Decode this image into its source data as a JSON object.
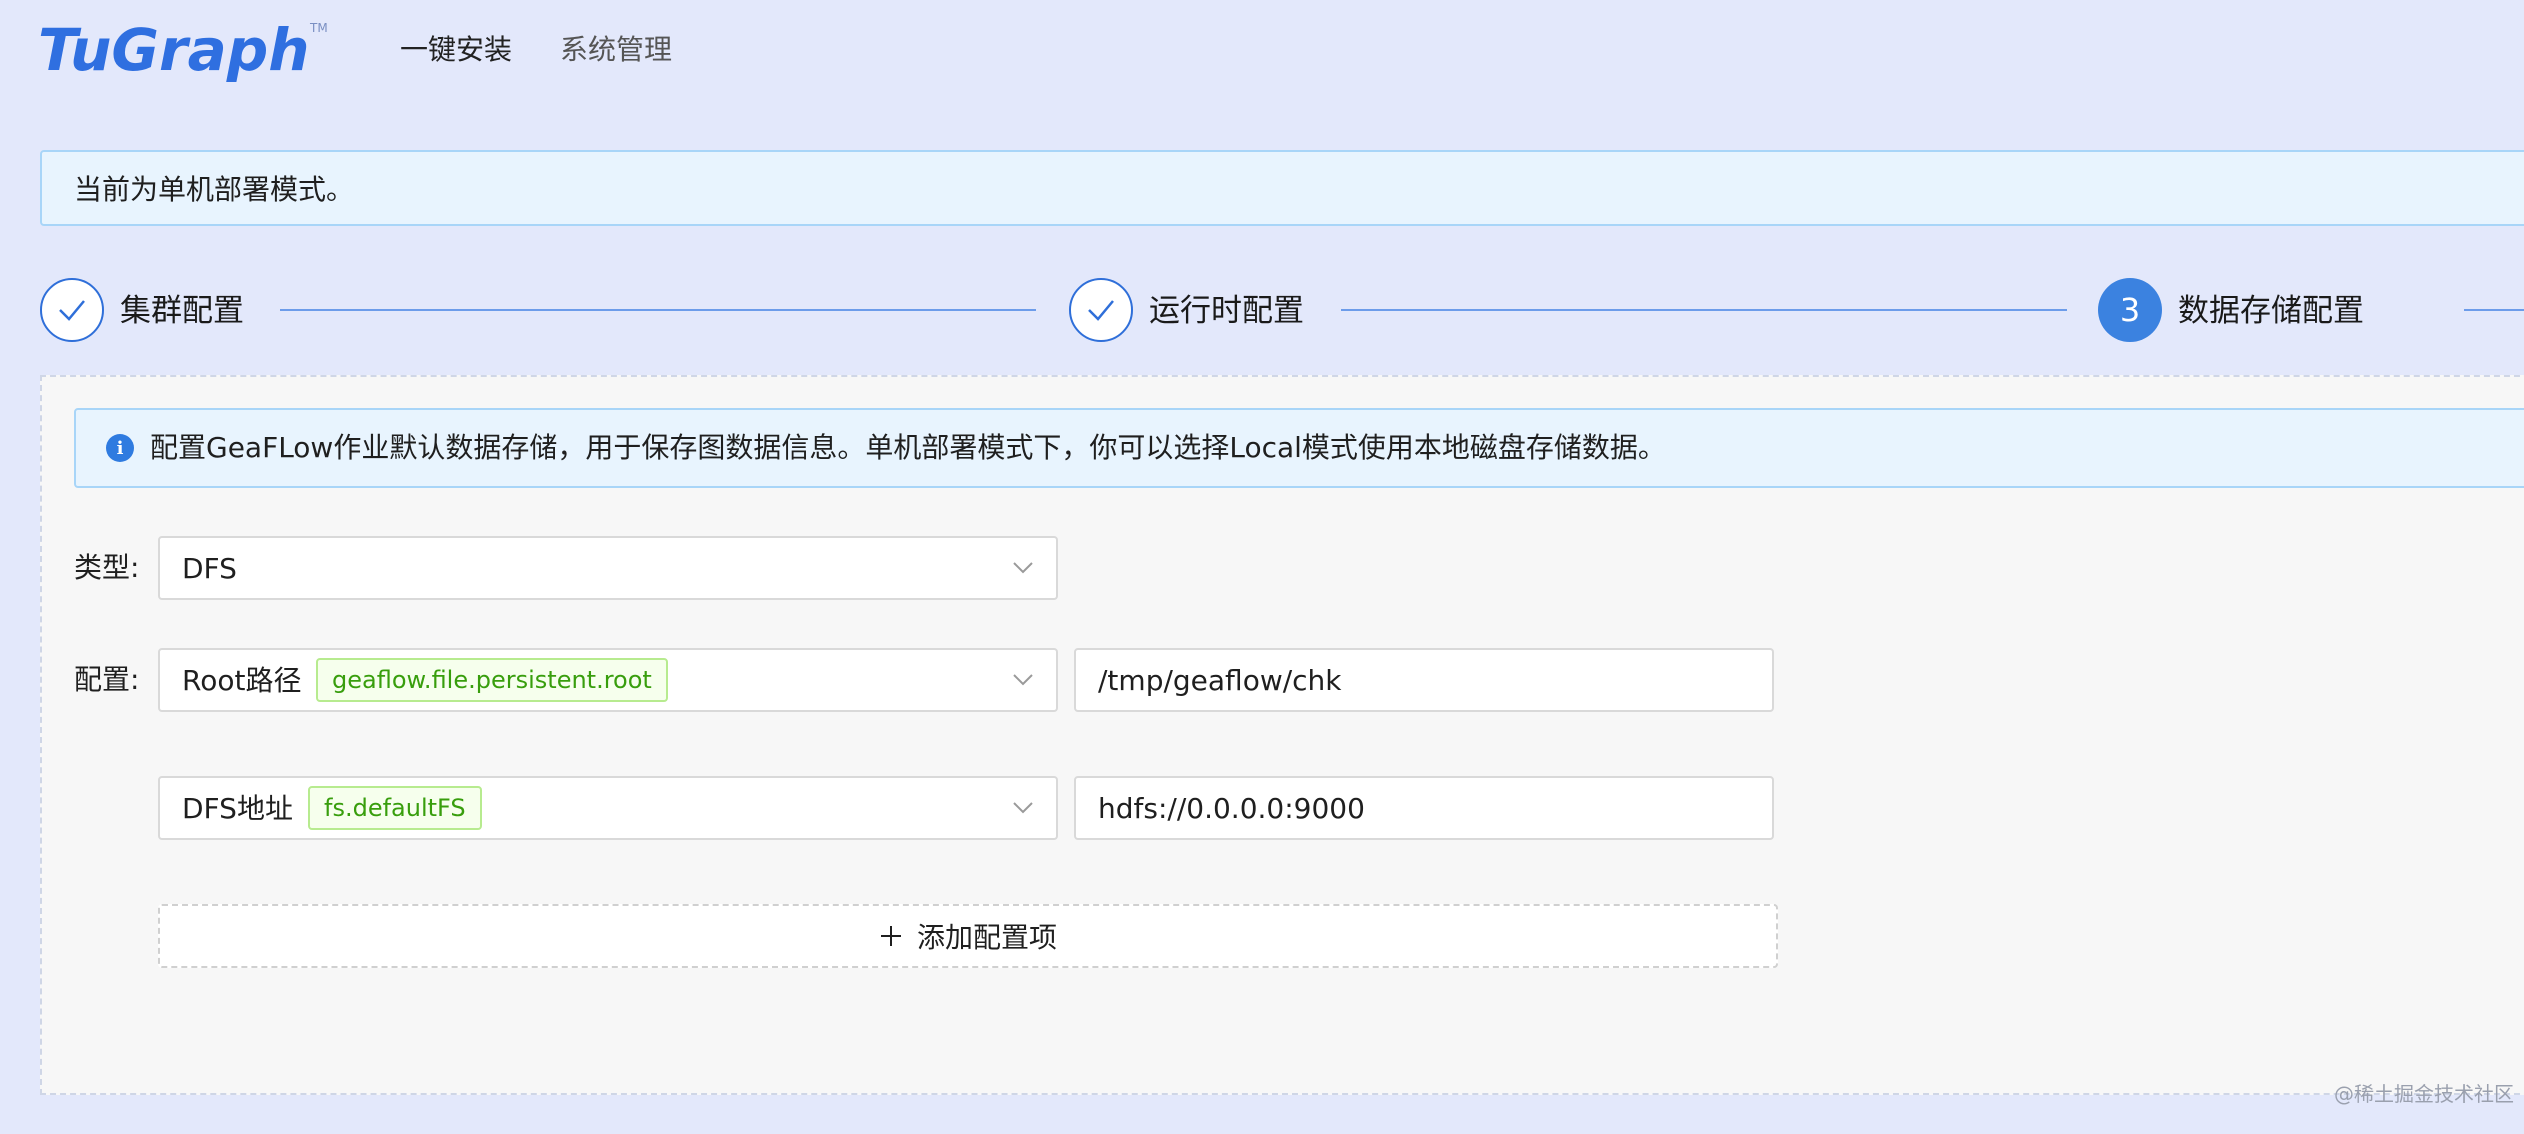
{
  "header": {
    "logo_text": "TuGraph",
    "logo_tm": "TM",
    "nav": [
      {
        "label": "一键安装"
      },
      {
        "label": "系统管理"
      }
    ]
  },
  "notice": {
    "text": "当前为单机部署模式。"
  },
  "steps": [
    {
      "label": "集群配置",
      "status": "done"
    },
    {
      "label": "运行时配置",
      "status": "done"
    },
    {
      "label": "数据存储配置",
      "status": "active",
      "number": "3"
    }
  ],
  "info": {
    "icon": "info-icon",
    "text": "配置GeaFLow作业默认数据存储，用于保存图数据信息。单机部署模式下，你可以选择Local模式使用本地磁盘存储数据。"
  },
  "form": {
    "type_label": "类型:",
    "type_value": "DFS",
    "config_label": "配置:",
    "configs": [
      {
        "key_label": "Root路径",
        "key_tag": "geaflow.file.persistent.root",
        "value": "/tmp/geaflow/chk"
      },
      {
        "key_label": "DFS地址",
        "key_tag": "fs.defaultFS",
        "value": "hdfs://0.0.0.0:9000"
      }
    ],
    "add_label": "添加配置项"
  },
  "watermark": "@稀土掘金技术社区",
  "colors": {
    "primary": "#3b82e0",
    "background": "#e3e8fb",
    "tag_green": "#389e0d"
  }
}
